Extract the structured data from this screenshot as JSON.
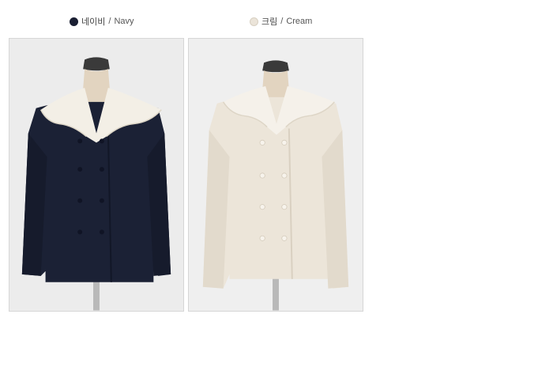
{
  "colors": [
    {
      "korean": "네이비",
      "separator": " / ",
      "english": "Navy",
      "swatch": "#1a1f33"
    },
    {
      "korean": "크림",
      "separator": " / ",
      "english": "Cream",
      "swatch": "#ebe4d9"
    }
  ],
  "images": [
    {
      "subject": "navy-blouse",
      "garment_color": "#1b2135",
      "collar_color": "#f3efe6"
    },
    {
      "subject": "cream-blouse",
      "garment_color": "#ece5d9",
      "collar_color": "#f5f1ea"
    }
  ]
}
